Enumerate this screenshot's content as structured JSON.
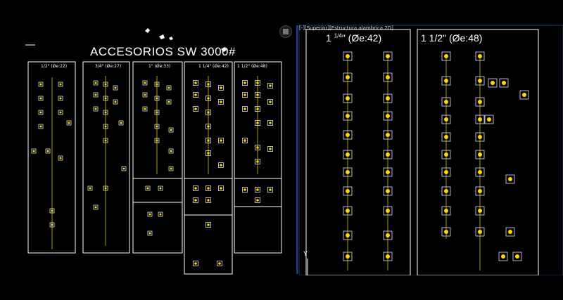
{
  "viewport": {
    "label": "[-][Superior][Estructura alambrica 2D]"
  },
  "drawing": {
    "title": "ACCESORIOS SW 3000#",
    "left_columns": [
      {
        "label": "1/2\" (Øe:22)"
      },
      {
        "label": "3/4\" (Øe:27)"
      },
      {
        "label": "1\" (Øe:33)"
      },
      {
        "label": "1 1/4\" (Øe:42)"
      },
      {
        "label": "1 1/2\" (Øe:48)"
      }
    ],
    "right_headers": {
      "col1": {
        "whole": "1",
        "frac": "1/4",
        "rest": "\" (Øe:42)"
      },
      "col2": {
        "label": "1 1/2\" (Øe:48)"
      }
    }
  },
  "axis": {
    "y_label": "Y"
  },
  "colors": {
    "frame": "#ffffff",
    "centerline": "#c8c800",
    "accent": "#ffd800",
    "viewport_border": "#1f3b7a"
  }
}
